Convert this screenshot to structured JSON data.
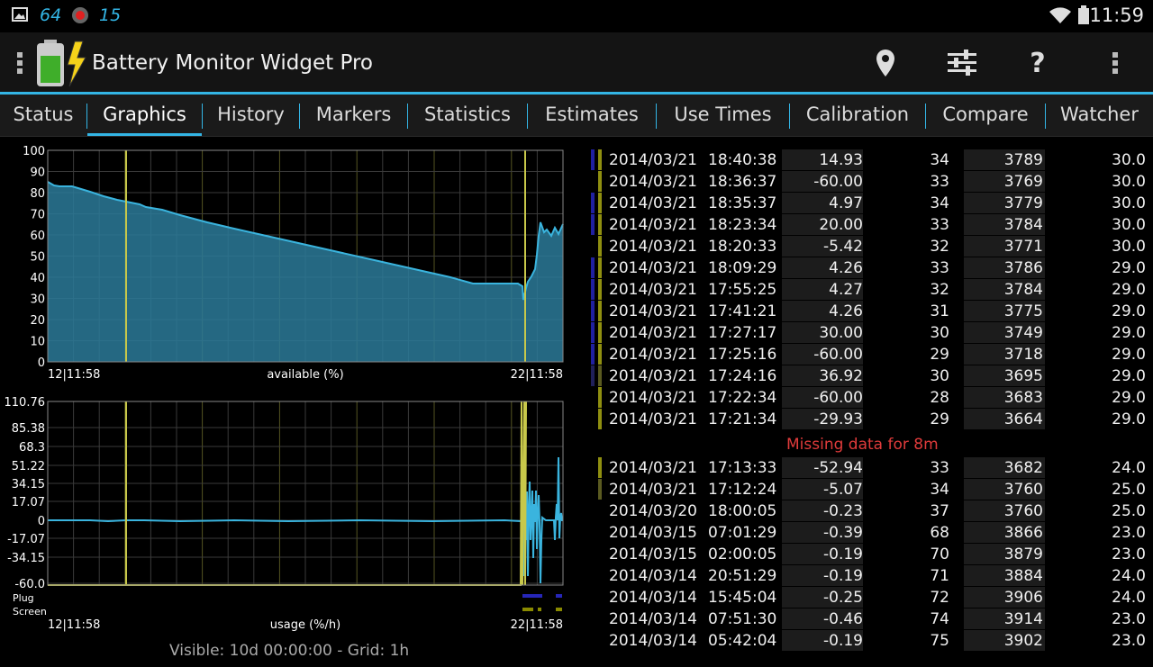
{
  "status_bar": {
    "time": "11:59",
    "notif_icons": [
      "image-icon",
      "64",
      "record-icon",
      "15"
    ],
    "status_icons": [
      "wifi-icon",
      "battery-icon"
    ]
  },
  "app": {
    "title": "Battery Monitor Widget Pro",
    "actions": [
      "location-icon",
      "sliders-icon",
      "help-icon",
      "overflow-menu-icon"
    ]
  },
  "tabs": [
    {
      "label": "Status"
    },
    {
      "label": "Graphics",
      "active": true
    },
    {
      "label": "History"
    },
    {
      "label": "Markers"
    },
    {
      "label": "Statistics"
    },
    {
      "label": "Estimates"
    },
    {
      "label": "Use Times"
    },
    {
      "label": "Calibration"
    },
    {
      "label": "Compare"
    },
    {
      "label": "Watcher"
    }
  ],
  "chart_top": {
    "y_ticks": [
      "100",
      "90",
      "80",
      "70",
      "60",
      "50",
      "40",
      "30",
      "20",
      "10",
      "0"
    ],
    "x_left": "12|11:58",
    "x_right": "22|11:58",
    "xlabel": "available (%)"
  },
  "chart_bottom": {
    "y_ticks": [
      "110.76",
      "85.38",
      "68.3",
      "51.22",
      "34.15",
      "17.07",
      "0",
      "-17.07",
      "-34.15",
      "-60.0"
    ],
    "x_left": "12|11:58",
    "x_right": "22|11:58",
    "xlabel": "usage (%/h)",
    "legend_plug": "Plug",
    "legend_screen": "Screen"
  },
  "footer": "Visible: 10d 00:00:00 - Grid: 1h",
  "colors": {
    "accent": "#33b5e5",
    "fill": "#2b7a99",
    "line": "#3ab4de",
    "marker_yellow": "#c8c84a",
    "plug_bar": "#2626b8",
    "screen_bar": "#8a8a00",
    "missing": "#e03b3b"
  },
  "table_rows": [
    {
      "date": "2014/03/21",
      "time": "18:40:38",
      "rate": "14.93",
      "pct": "34",
      "mv": "3789",
      "temp": "30.0",
      "b1": "#2020a0",
      "b2": "#8f8f10"
    },
    {
      "date": "2014/03/21",
      "time": "18:36:37",
      "rate": "-60.00",
      "pct": "33",
      "mv": "3769",
      "temp": "30.0",
      "b1": "",
      "b2": "#8f8f10"
    },
    {
      "date": "2014/03/21",
      "time": "18:35:37",
      "rate": "4.97",
      "pct": "34",
      "mv": "3779",
      "temp": "30.0",
      "b1": "#2020a0",
      "b2": "#8f8f10"
    },
    {
      "date": "2014/03/21",
      "time": "18:23:34",
      "rate": "20.00",
      "pct": "33",
      "mv": "3784",
      "temp": "30.0",
      "b1": "#2020a0",
      "b2": "#8f8f10"
    },
    {
      "date": "2014/03/21",
      "time": "18:20:33",
      "rate": "-5.42",
      "pct": "32",
      "mv": "3771",
      "temp": "30.0",
      "b1": "",
      "b2": "#8f8f10"
    },
    {
      "date": "2014/03/21",
      "time": "18:09:29",
      "rate": "4.26",
      "pct": "33",
      "mv": "3786",
      "temp": "29.0",
      "b1": "#2020a0",
      "b2": "#8f8f10"
    },
    {
      "date": "2014/03/21",
      "time": "17:55:25",
      "rate": "4.27",
      "pct": "32",
      "mv": "3784",
      "temp": "29.0",
      "b1": "#2020a0",
      "b2": "#8f8f10"
    },
    {
      "date": "2014/03/21",
      "time": "17:41:21",
      "rate": "4.26",
      "pct": "31",
      "mv": "3775",
      "temp": "29.0",
      "b1": "#2020a0",
      "b2": "#8f8f10"
    },
    {
      "date": "2014/03/21",
      "time": "17:27:17",
      "rate": "30.00",
      "pct": "30",
      "mv": "3749",
      "temp": "29.0",
      "b1": "#2020a0",
      "b2": "#8f8f10"
    },
    {
      "date": "2014/03/21",
      "time": "17:25:16",
      "rate": "-60.00",
      "pct": "29",
      "mv": "3718",
      "temp": "29.0",
      "b1": "#2020a0",
      "b2": "#8f8f10"
    },
    {
      "date": "2014/03/21",
      "time": "17:24:16",
      "rate": "36.92",
      "pct": "30",
      "mv": "3695",
      "temp": "29.0",
      "b1": "#20205a",
      "b2": "#5a5a20"
    },
    {
      "date": "2014/03/21",
      "time": "17:22:34",
      "rate": "-60.00",
      "pct": "28",
      "mv": "3683",
      "temp": "29.0",
      "b1": "",
      "b2": "#8f8f10"
    },
    {
      "date": "2014/03/21",
      "time": "17:21:34",
      "rate": "-29.93",
      "pct": "29",
      "mv": "3664",
      "temp": "29.0",
      "b1": "",
      "b2": "#8f8f10"
    }
  ],
  "missing_text": "Missing data for 8m",
  "table_rows_after": [
    {
      "date": "2014/03/21",
      "time": "17:13:33",
      "rate": "-52.94",
      "pct": "33",
      "mv": "3682",
      "temp": "24.0",
      "b1": "",
      "b2": "#8f8f10"
    },
    {
      "date": "2014/03/21",
      "time": "17:12:24",
      "rate": "-5.07",
      "pct": "34",
      "mv": "3760",
      "temp": "25.0",
      "b1": "",
      "b2": "#5a5a20"
    },
    {
      "date": "2014/03/20",
      "time": "18:00:05",
      "rate": "-0.23",
      "pct": "37",
      "mv": "3760",
      "temp": "25.0",
      "b1": "",
      "b2": ""
    },
    {
      "date": "2014/03/15",
      "time": "07:01:29",
      "rate": "-0.39",
      "pct": "68",
      "mv": "3866",
      "temp": "23.0",
      "b1": "",
      "b2": ""
    },
    {
      "date": "2014/03/15",
      "time": "02:00:05",
      "rate": "-0.19",
      "pct": "70",
      "mv": "3879",
      "temp": "23.0",
      "b1": "",
      "b2": ""
    },
    {
      "date": "2014/03/14",
      "time": "20:51:29",
      "rate": "-0.19",
      "pct": "71",
      "mv": "3884",
      "temp": "24.0",
      "b1": "",
      "b2": ""
    },
    {
      "date": "2014/03/14",
      "time": "15:45:04",
      "rate": "-0.25",
      "pct": "72",
      "mv": "3906",
      "temp": "24.0",
      "b1": "",
      "b2": ""
    },
    {
      "date": "2014/03/14",
      "time": "07:51:30",
      "rate": "-0.46",
      "pct": "74",
      "mv": "3914",
      "temp": "23.0",
      "b1": "",
      "b2": ""
    },
    {
      "date": "2014/03/14",
      "time": "05:42:04",
      "rate": "-0.19",
      "pct": "75",
      "mv": "3902",
      "temp": "23.0",
      "b1": "",
      "b2": ""
    }
  ]
}
